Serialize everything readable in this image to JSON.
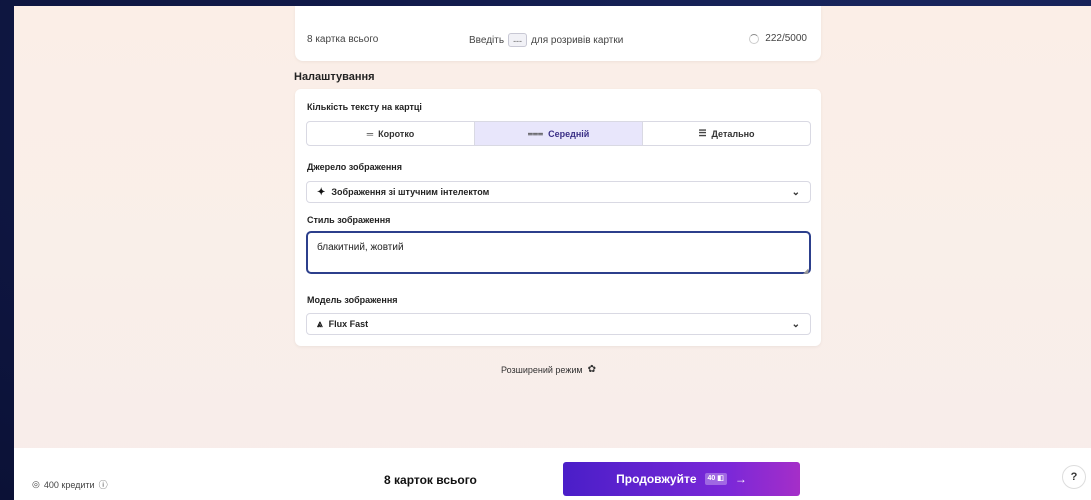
{
  "top_card": {
    "count_text": "8 картка всього",
    "hint_before": "Введіть",
    "hint_kbd": "---",
    "hint_after": "для розривів картки",
    "char_count": "222/5000"
  },
  "settings": {
    "section_title": "Налаштування",
    "text_amount": {
      "label": "Кількість тексту на картці",
      "options": [
        {
          "label": "Коротко",
          "icon": "lines-short-icon",
          "glyph": "═",
          "active": false
        },
        {
          "label": "Середній",
          "icon": "lines-medium-icon",
          "glyph": "⩶",
          "active": true
        },
        {
          "label": "Детально",
          "icon": "lines-detailed-icon",
          "glyph": "☰",
          "active": false
        }
      ]
    },
    "image_source": {
      "label": "Джерело зображення",
      "value": "Зображення зі штучним інтелектом",
      "icon": "sparkle-icon",
      "glyph": "✦"
    },
    "image_style": {
      "label": "Стиль зображення",
      "value": "блакитний, жовтий"
    },
    "image_model": {
      "label": "Модель зображення",
      "value": "Flux Fast",
      "icon": "flux-logo-icon",
      "glyph": "⩓"
    },
    "advanced_label": "Розширений режим"
  },
  "bottom_bar": {
    "credits": "400 кредити",
    "total": "8 карток всього",
    "continue_label": "Продовжуйте",
    "continue_badge": "40 ◧"
  },
  "colors": {
    "accent_start": "#4a1ec8",
    "accent_end": "#a52ec8",
    "active_segment": "#e8e6fb",
    "focus_border": "#2c3f8c"
  }
}
